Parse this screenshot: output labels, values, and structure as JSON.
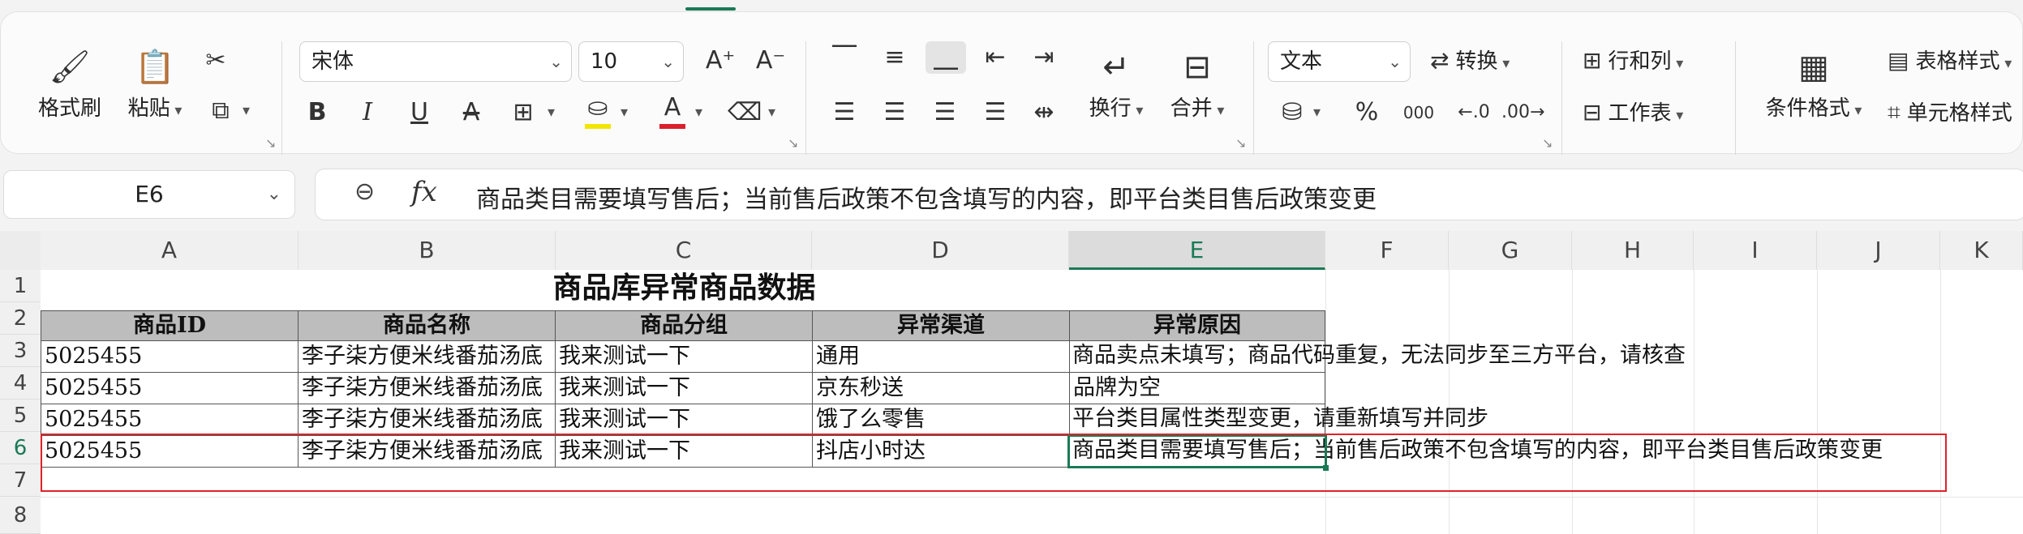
{
  "toolbar": {
    "format_painter": "格式刷",
    "paste": "粘贴",
    "font_name": "宋体",
    "font_size": "10",
    "wrap": "换行",
    "merge": "合并",
    "number_format": "文本",
    "convert": "转换",
    "rows_cols": "行和列",
    "worksheet": "工作表",
    "conditional_format": "条件格式",
    "table_style": "表格样式",
    "cell_style": "单元格样式",
    "bold": "B",
    "italic": "I",
    "underline": "U",
    "strike": "A",
    "percent": "%",
    "thousands": "000",
    "font_color_letter": "A",
    "grow_font": "A⁺",
    "shrink_font": "A⁻"
  },
  "formula_bar": {
    "cell_ref": "E6",
    "fx": "fx",
    "content": "商品类目需要填写售后；当前售后政策不包含填写的内容，即平台类目售后政策变更"
  },
  "columns": [
    "A",
    "B",
    "C",
    "D",
    "E",
    "F",
    "G",
    "H",
    "I",
    "J",
    "K"
  ],
  "rows": [
    "1",
    "2",
    "3",
    "4",
    "5",
    "6",
    "7",
    "8"
  ],
  "sheet": {
    "title": "商品库异常商品数据",
    "headers": [
      "商品ID",
      "商品名称",
      "商品分组",
      "异常渠道",
      "异常原因"
    ],
    "data": [
      [
        "5025455",
        "李子柒方便米线番茄汤底",
        "我来测试一下",
        "通用",
        "商品卖点未填写；商品代码重复，无法同步至三方平台，请核查"
      ],
      [
        "5025455",
        "李子柒方便米线番茄汤底",
        "我来测试一下",
        "京东秒送",
        "品牌为空"
      ],
      [
        "5025455",
        "李子柒方便米线番茄汤底",
        "我来测试一下",
        "饿了么零售",
        "平台类目属性类型变更，请重新填写并同步"
      ],
      [
        "5025455",
        "李子柒方便米线番茄汤底",
        "我来测试一下",
        "抖店小时达",
        "商品类目需要填写售后；当前售后政策不包含填写的内容，即平台类目售后政策变更"
      ]
    ]
  },
  "colors": {
    "accent": "#1a7a55",
    "header_fill": "#bdbdbd",
    "annotation": "#e0222a",
    "font_color_bar": "#d9202c",
    "highlight_bar": "#f2e600"
  }
}
